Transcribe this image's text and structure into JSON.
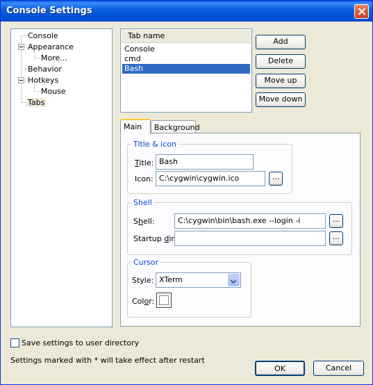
{
  "window": {
    "title": "Console Settings"
  },
  "tree": {
    "items": [
      "Console",
      "Appearance",
      "More...",
      "Behavior",
      "Hotkeys",
      "Mouse",
      "Tabs"
    ],
    "selected": "Tabs"
  },
  "tablist": {
    "header": "Tab name",
    "rows": [
      "Console",
      "cmd",
      "Bash"
    ],
    "selected": "Bash"
  },
  "buttons": {
    "add": "Add",
    "delete": "Delete",
    "move_up": "Move up",
    "move_down": "Move down",
    "ok": "OK",
    "cancel": "Cancel",
    "browse": "..."
  },
  "tabs": {
    "main": "Main",
    "background": "Background",
    "active": "Main"
  },
  "title_icon": {
    "group": "Title & icon",
    "title_label_u": "T",
    "title_label_rest": "itle:",
    "title_value": "Bash",
    "icon_label": "Icon:",
    "icon_value": "C:\\cygwin\\cygwin.ico"
  },
  "shell": {
    "group": "Shell",
    "shell_label_a": "S",
    "shell_label_u": "h",
    "shell_label_b": "ell:",
    "shell_value": "C:\\cygwin\\bin\\bash.exe --login -i",
    "dir_label_a": "Startup ",
    "dir_label_u": "d",
    "dir_label_b": "ir:",
    "dir_value": ""
  },
  "cursor": {
    "group": "Cursor",
    "style_label": "Style:",
    "style_value": "XTerm",
    "color_label_a": "Col",
    "color_label_u": "o",
    "color_label_b": "r:",
    "color_value": "#ffffff"
  },
  "footer": {
    "save_label": "Save settings to user directory",
    "save_checked": false,
    "note": "Settings marked with * will take effect after restart"
  }
}
